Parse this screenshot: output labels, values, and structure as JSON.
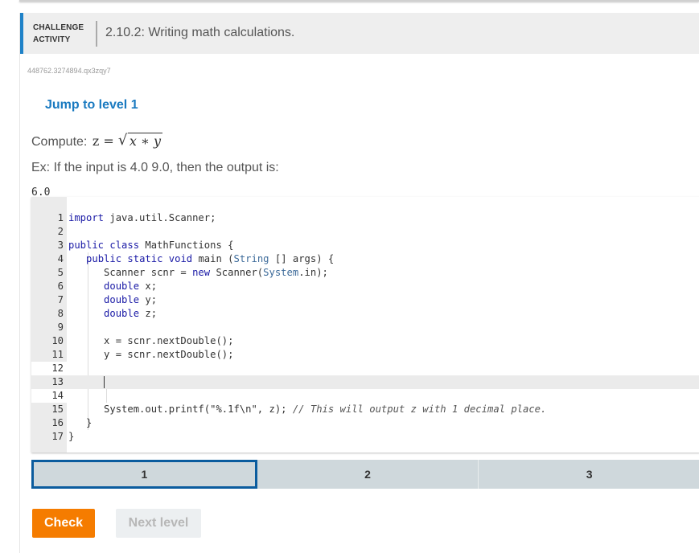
{
  "header": {
    "kind_line1": "CHALLENGE",
    "kind_line2": "ACTIVITY",
    "title": "2.10.2: Writing math calculations.",
    "accent_color": "#1f82c8"
  },
  "activity_id": "448762.3274894.qx3zqy7",
  "jump_link": "Jump to level 1",
  "prompt": {
    "label": "Compute:",
    "lhs": "z",
    "equals": "=",
    "radicand_x": "x",
    "radicand_op": "∗",
    "radicand_y": "y"
  },
  "example": {
    "text": "Ex: If the input is 4.0 9.0, then the output is:",
    "output": "6.0"
  },
  "editor": {
    "active_line": 13,
    "lines": [
      {
        "n": "1"
      },
      {
        "n": "2"
      },
      {
        "n": "3"
      },
      {
        "n": "4"
      },
      {
        "n": "5"
      },
      {
        "n": "6"
      },
      {
        "n": "7"
      },
      {
        "n": "8"
      },
      {
        "n": "9"
      },
      {
        "n": "10"
      },
      {
        "n": "11"
      },
      {
        "n": "12"
      },
      {
        "n": "13"
      },
      {
        "n": "14"
      },
      {
        "n": "15"
      },
      {
        "n": "16"
      },
      {
        "n": "17"
      }
    ],
    "code": {
      "l1_kw": "import",
      "l1_rest": " java.util.Scanner;",
      "l3_kw1": "public",
      "l3_kw2": "class",
      "l3_rest": " MathFunctions {",
      "l4_kw1": "public",
      "l4_kw2": "static",
      "l4_kw3": "void",
      "l4_mid": " main (",
      "l4_type": "String",
      "l4_rest": " [] args) {",
      "l5_a": "Scanner scnr = ",
      "l5_kw": "new",
      "l5_b": " Scanner(",
      "l5_st": "System",
      "l5_c": ".in);",
      "l6_kw": "double",
      "l6_rest": " x;",
      "l7_kw": "double",
      "l7_rest": " y;",
      "l8_kw": "double",
      "l8_rest": " z;",
      "l10": "x = scnr.nextDouble();",
      "l11": "y = scnr.nextDouble();",
      "l15_code": "System.out.printf(\"%.1f\\n\", z); ",
      "l15_comment": "// This will output z with 1 decimal place.",
      "l16": "}",
      "l17": "}"
    }
  },
  "levels": [
    {
      "label": "1",
      "current": true
    },
    {
      "label": "2",
      "current": false
    },
    {
      "label": "3",
      "current": false
    }
  ],
  "buttons": {
    "check": "Check",
    "next_level": "Next level",
    "check_color": "#f57c00"
  }
}
